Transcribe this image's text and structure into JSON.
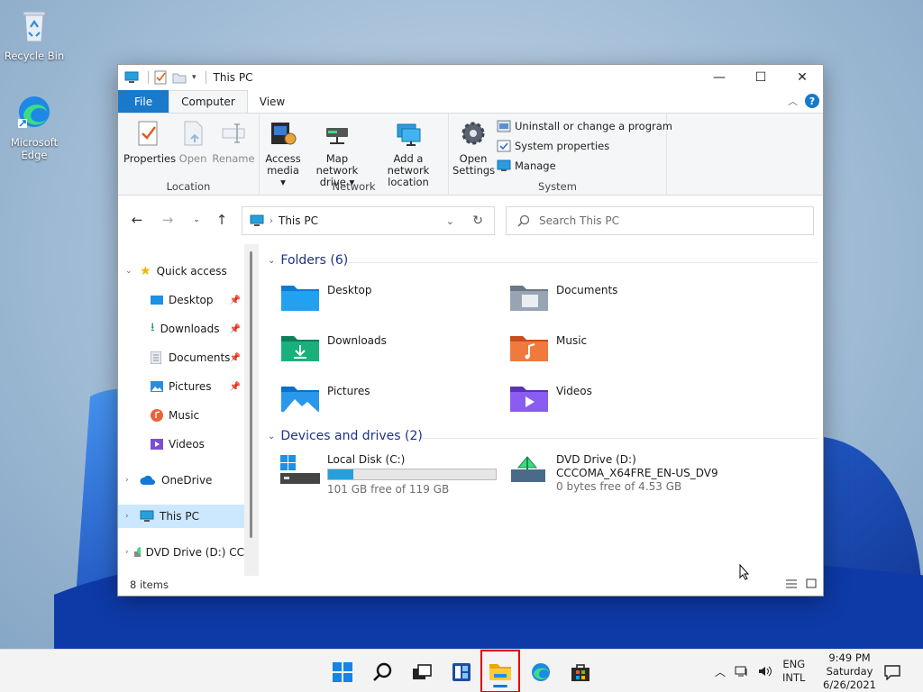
{
  "desktop": {
    "icons": [
      {
        "label": "Recycle Bin",
        "icon": "recycle-bin-icon"
      },
      {
        "label": "Microsoft Edge",
        "icon": "edge-icon"
      }
    ]
  },
  "window": {
    "title": "This PC",
    "controls": {
      "minimize": "—",
      "maximize": "☐",
      "close": "✕"
    }
  },
  "ribbon": {
    "tabs": {
      "file": "File",
      "computer": "Computer",
      "view": "View"
    },
    "groups": {
      "location": {
        "label": "Location",
        "properties": "Properties",
        "open": "Open",
        "rename": "Rename"
      },
      "network": {
        "label": "Network",
        "access_media_1": "Access",
        "access_media_2": "media ▾",
        "map_drive_1": "Map network",
        "map_drive_2": "drive ▾",
        "add_location_1": "Add a network",
        "add_location_2": "location"
      },
      "system": {
        "label": "System",
        "open_settings_1": "Open",
        "open_settings_2": "Settings",
        "uninstall": "Uninstall or change a program",
        "system_properties": "System properties",
        "manage": "Manage"
      }
    }
  },
  "address": {
    "path": "This PC",
    "search_placeholder": "Search This PC"
  },
  "nav": {
    "quick_access": "Quick access",
    "items": [
      "Desktop",
      "Downloads",
      "Documents",
      "Pictures",
      "Music",
      "Videos"
    ],
    "onedrive": "OneDrive",
    "this_pc": "This PC",
    "dvd": "DVD Drive (D:) CC"
  },
  "content": {
    "folders_header": "Folders (6)",
    "folders": [
      "Desktop",
      "Documents",
      "Downloads",
      "Music",
      "Pictures",
      "Videos"
    ],
    "drives_header": "Devices and drives (2)",
    "drives": [
      {
        "name": "Local Disk (C:)",
        "free": "101 GB free of 119 GB",
        "used_fraction": 0.15
      },
      {
        "name": "DVD Drive (D:)",
        "label": "CCCOMA_X64FRE_EN-US_DV9",
        "free": "0 bytes free of 4.53 GB"
      }
    ]
  },
  "status": {
    "items": "8 items"
  },
  "taskbar": {
    "lang_1": "ENG",
    "lang_2": "INTL",
    "time": "9:49 PM",
    "day": "Saturday",
    "date": "6/26/2021"
  },
  "colors": {
    "accent": "#1979ca",
    "selection": "#cce8ff",
    "header": "#1e3287",
    "highlight": "#e00000"
  }
}
